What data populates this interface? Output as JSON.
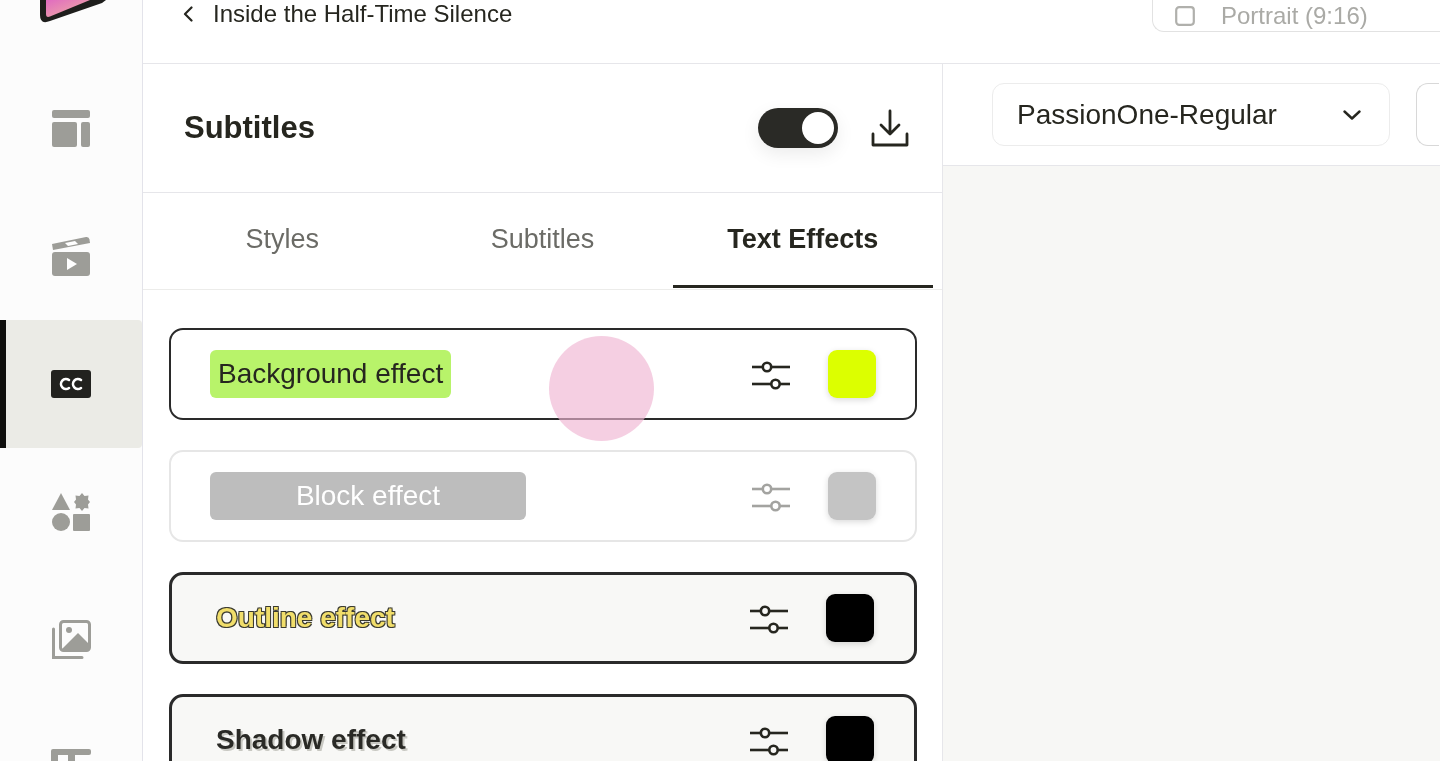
{
  "app_bar": {
    "title": "Inside the Half-Time Silence",
    "format": {
      "value": "Portrait (9:16)"
    }
  },
  "sidebar": {
    "items": [
      {
        "selected": false
      },
      {
        "selected": false
      },
      {
        "selected": true
      },
      {
        "selected": false
      },
      {
        "selected": false
      },
      {
        "selected": false
      }
    ]
  },
  "subtitles_panel": {
    "title": "Subtitles",
    "enabled": true,
    "tabs": [
      {
        "label": "Styles",
        "selected": false
      },
      {
        "label": "Subtitles",
        "selected": false
      },
      {
        "label": "Text Effects",
        "selected": true
      }
    ],
    "effects": [
      {
        "kind": "background",
        "label": "Background effect",
        "disabled": false,
        "color": "#dcff00"
      },
      {
        "kind": "block",
        "label": "Block effect",
        "disabled": true,
        "color": "#c4c4c4"
      },
      {
        "kind": "outline",
        "label": "Outline effect",
        "disabled": false,
        "color": "#000000"
      },
      {
        "kind": "shadow",
        "label": "Shadow effect",
        "disabled": false,
        "color": "#000000"
      }
    ]
  },
  "editor_toolbar": {
    "font": {
      "value": "PassionOne-Regular"
    }
  }
}
